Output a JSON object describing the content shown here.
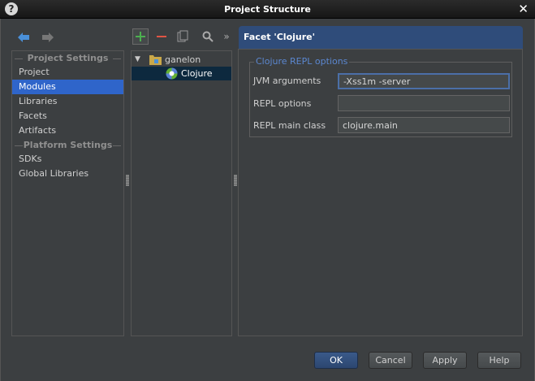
{
  "window": {
    "title": "Project Structure"
  },
  "sidebar": {
    "groups": [
      {
        "header": "Project Settings",
        "items": [
          "Project",
          "Modules",
          "Libraries",
          "Facets",
          "Artifacts"
        ]
      },
      {
        "header": "Platform Settings",
        "items": [
          "SDKs",
          "Global Libraries"
        ]
      }
    ],
    "selected": "Modules"
  },
  "tree": {
    "root": "ganelon",
    "child": "Clojure"
  },
  "facet": {
    "header": "Facet 'Clojure'",
    "group_legend": "Clojure REPL options",
    "fields": [
      {
        "label": "JVM arguments",
        "value": "-Xss1m -server"
      },
      {
        "label": "REPL options",
        "value": ""
      },
      {
        "label": "REPL main class",
        "value": "clojure.main"
      }
    ]
  },
  "buttons": {
    "ok": "OK",
    "cancel": "Cancel",
    "apply": "Apply",
    "help": "Help"
  },
  "colors": {
    "accent": "#2f65ca",
    "header": "#2f4c7a",
    "legend": "#5b87d0"
  }
}
